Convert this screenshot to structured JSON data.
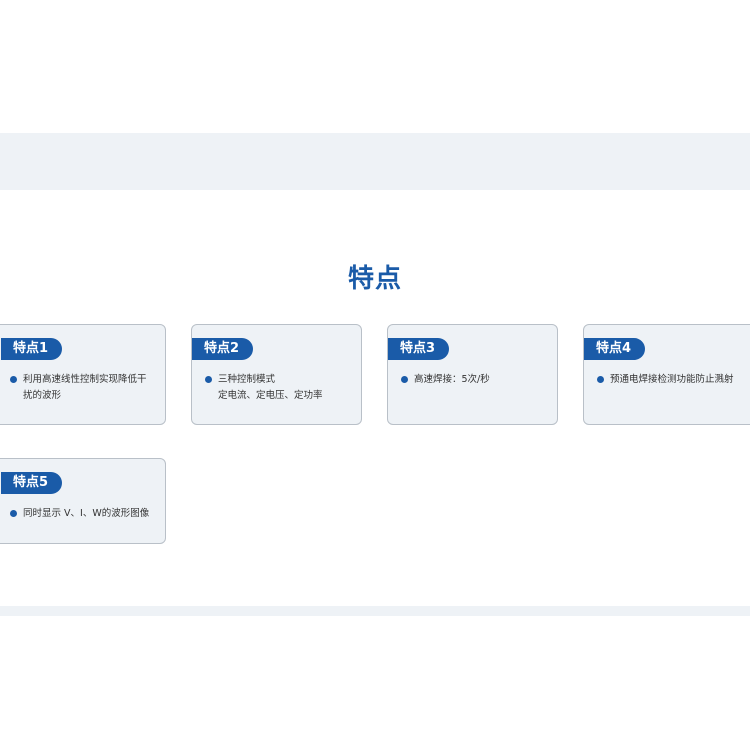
{
  "section": {
    "title": "特点"
  },
  "features": [
    {
      "tag": "特点1",
      "lines": [
        "利用高速线性控制实现降低干",
        "扰的波形"
      ]
    },
    {
      "tag": "特点2",
      "lines": [
        "三种控制模式",
        "定电流、定电压、定功率"
      ]
    },
    {
      "tag": "特点3",
      "lines": [
        "高速焊接：5次/秒"
      ]
    },
    {
      "tag": "特点4",
      "lines": [
        "预通电焊接检测功能防止溅射"
      ]
    },
    {
      "tag": "特点5",
      "lines": [
        "同时显示 V、I、W的波形图像"
      ]
    }
  ],
  "colors": {
    "accent": "#1a5ba8",
    "band": "#eef2f6",
    "card_border": "#b9c0c8",
    "text": "#333333"
  },
  "icons": {
    "bullet": "bullet-dot-icon"
  }
}
